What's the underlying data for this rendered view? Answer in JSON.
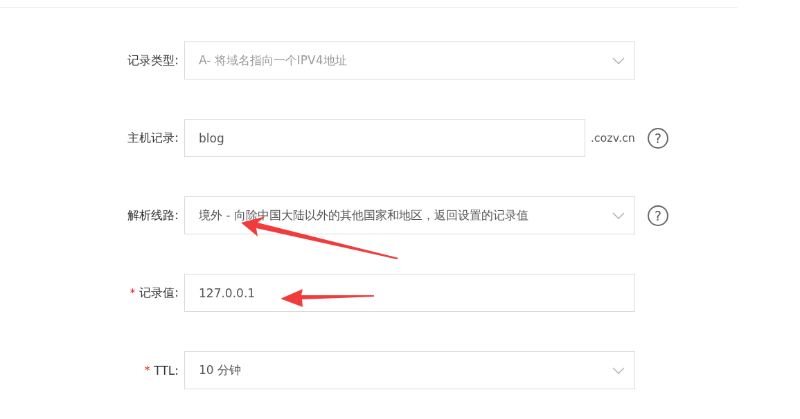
{
  "form": {
    "rows": [
      {
        "kind": "select",
        "label": "记录类型:",
        "disabled": true,
        "value": "A- 将域名指向一个IPV4地址"
      },
      {
        "kind": "text",
        "label": "主机记录:",
        "disabled": false,
        "value": "blog",
        "suffix": ".cozv.cn",
        "help": "?"
      },
      {
        "kind": "select",
        "label": "解析线路:",
        "disabled": false,
        "value": "境外 - 向除中国大陆以外的其他国家和地区，返回设置的记录值",
        "help": "?"
      },
      {
        "kind": "text",
        "label": "记录值:",
        "required_mark": "*",
        "disabled": false,
        "value": "127.0.0.1"
      },
      {
        "kind": "select",
        "label": "TTL:",
        "required_mark": "*",
        "disabled": false,
        "value": "10 分钟"
      }
    ]
  }
}
